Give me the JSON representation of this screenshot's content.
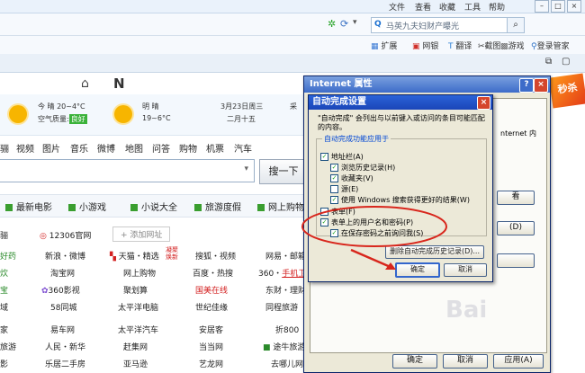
{
  "menubar": {
    "items": [
      "文件",
      "查看",
      "收藏",
      "工具",
      "帮助"
    ]
  },
  "address": {
    "search_text": "马英九夫妇财产曝光"
  },
  "toolbar": {
    "items": [
      "扩展",
      "网银",
      "翻译",
      "截图",
      "游戏",
      "登录管家"
    ]
  },
  "tabs": {
    "home_icon": "home-icon",
    "n_icon": "N"
  },
  "weather": {
    "today": {
      "label": "今 晴 20~4°C",
      "quality_label": "空气质量:",
      "quality": "良好"
    },
    "tomorrow": {
      "label": "明 晴",
      "temp": "19~6°C"
    },
    "date": {
      "line1": "3月23日周三",
      "line2": "二月十五"
    },
    "extra": "采"
  },
  "nav_links": [
    "骊",
    "视频",
    "图片",
    "音乐",
    "微博",
    "地图",
    "问答",
    "购物",
    "机票",
    "汽车"
  ],
  "search": {
    "button": "搜一下"
  },
  "categories": [
    {
      "label": "最新电影",
      "color": "#3a9e2f"
    },
    {
      "label": "小游戏",
      "color": "#3a9e2f"
    },
    {
      "label": "小说大全",
      "color": "#3a9e2f"
    },
    {
      "label": "旅游度假",
      "color": "#3a9e2f"
    },
    {
      "label": "网上购物",
      "color": "#3a9e2f"
    }
  ],
  "sites": {
    "row0": [
      "骊",
      "12306官网",
      "+ 添加网址"
    ],
    "row1": [
      "好药",
      "新浪・微博",
      "天猫・精选",
      "凝聚焕新",
      "搜狐・视频",
      "网易・邮箱"
    ],
    "row2": [
      "炊",
      "淘宝网",
      "网上购物",
      "百度・热搜",
      "360・",
      "手机卫"
    ],
    "row3": [
      "宝",
      "360影视",
      "聚划算",
      "国美在线",
      "东财・理财"
    ],
    "row4": [
      "域",
      "58同城",
      "太平洋电脑",
      "世纪佳缘",
      "同程旅游"
    ],
    "row5": [
      "家",
      "易车网",
      "太平洋汽车",
      "安居客",
      "折800"
    ],
    "row6": [
      "旅游",
      "人民・新华",
      "赶集网",
      "当当网",
      "途牛旅游"
    ],
    "row7": [
      "影",
      "乐居二手房",
      "亚马逊",
      "艺龙网",
      "去哪儿网"
    ]
  },
  "inet_dialog": {
    "title": "Internet 属性",
    "side_text": "nternet 内",
    "side_btn1": "看",
    "side_btn2": "(D)",
    "ok": "确定",
    "cancel": "取消",
    "apply": "应用(A)"
  },
  "autocomplete_dialog": {
    "title": "自动完成设置",
    "description": "\"自动完成\" 会列出与以前键入或访问的条目可能匹配的内容。",
    "group_label": "自动完成功能应用于",
    "items": [
      {
        "label": "地址栏(A)",
        "checked": "✓"
      },
      {
        "label": "浏览历史记录(H)",
        "checked": "✓"
      },
      {
        "label": "收藏夹(V)",
        "checked": "✓"
      },
      {
        "label": "源(E)",
        "checked": ""
      },
      {
        "label": "使用 Windows 搜索获得更好的结果(W)",
        "checked": "✓"
      },
      {
        "label": "表单(F)",
        "checked": ""
      },
      {
        "label": "表单上的用户名和密码(P)",
        "checked": "✓"
      },
      {
        "label": "在保存密码之前询问我(S)",
        "checked": "✓"
      }
    ],
    "clear_button": "删除自动完成历史记录(D)...",
    "ok": "确定",
    "cancel": "取消"
  },
  "corner_badge": "秒杀",
  "watermark": "Bai"
}
